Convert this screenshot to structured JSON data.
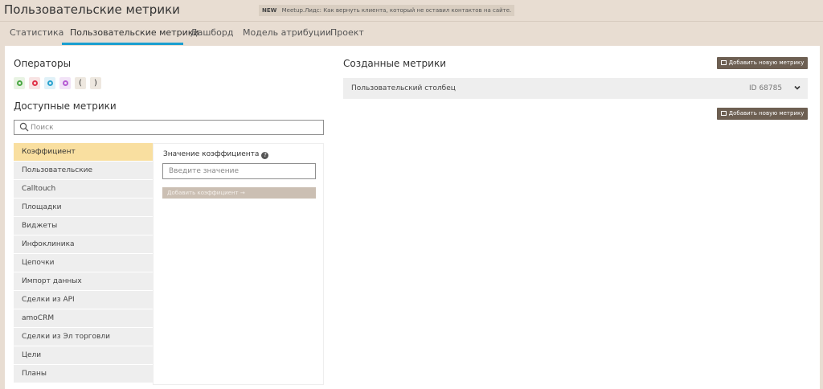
{
  "header": {
    "title": "Пользовательские метрики",
    "news_badge": "NEW",
    "news_text": "Meetup.Лидс: Как вернуть клиента, который не оставил контактов на сайте."
  },
  "tabs": [
    {
      "label": "Статистика"
    },
    {
      "label": "Пользовательские метрики",
      "active": true
    },
    {
      "label": "Дашборд"
    },
    {
      "label": "Модель атрибуции"
    },
    {
      "label": "Проект"
    }
  ],
  "operators": {
    "title": "Операторы",
    "items": [
      {
        "name": "plus",
        "color": "#4aa843"
      },
      {
        "name": "minus",
        "color": "#e0334a"
      },
      {
        "name": "multiply",
        "color": "#2aa3cf"
      },
      {
        "name": "divide",
        "color": "#b55bd3"
      },
      {
        "label": "("
      },
      {
        "label": ")"
      }
    ]
  },
  "available": {
    "title": "Доступные метрики",
    "search_placeholder": "Поиск",
    "categories": [
      "Коэффициент",
      "Пользовательские",
      "Calltouch",
      "Площадки",
      "Виджеты",
      "Инфоклиника",
      "Цепочки",
      "Импорт данных",
      "Сделки из API",
      "amoCRM",
      "Сделки из Эл торговли",
      "Цели",
      "Планы"
    ],
    "coefficient": {
      "label": "Значение коэффициента",
      "help_icon": "?",
      "placeholder": "Введите значение",
      "button": "Добавить коэффициент →"
    }
  },
  "created": {
    "title": "Созданные метрики",
    "add_button": "Добавить новую метрику",
    "metrics": [
      {
        "name": "Пользовательский столбец",
        "id": "ID 68785"
      }
    ]
  },
  "colors": {
    "accent": "#1a9fd0",
    "button_dark": "#6d5f52",
    "active_category": "#f9dfa0"
  }
}
